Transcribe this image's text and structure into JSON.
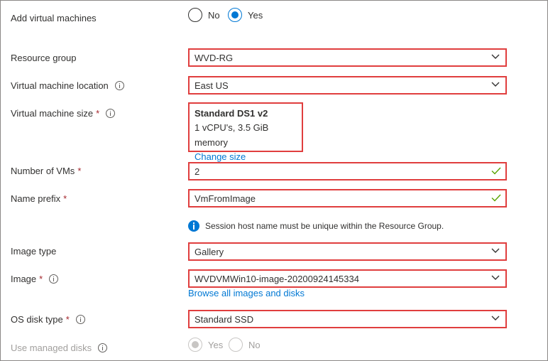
{
  "add_vms": {
    "label": "Add virtual machines",
    "options": [
      "No",
      "Yes"
    ],
    "selected": "Yes"
  },
  "resource_group": {
    "label": "Resource group",
    "value": "WVD-RG"
  },
  "vm_location": {
    "label": "Virtual machine location",
    "value": "East US"
  },
  "vm_size": {
    "label": "Virtual machine size",
    "required": "*",
    "title": "Standard DS1 v2",
    "spec": "1 vCPU's, 3.5 GiB memory",
    "change_link": "Change size"
  },
  "num_vms": {
    "label": "Number of VMs",
    "required": "*",
    "value": "2"
  },
  "name_prefix": {
    "label": "Name prefix",
    "required": "*",
    "value": "VmFromImage"
  },
  "notice": {
    "text": "Session host name must be unique within the Resource Group."
  },
  "image_type": {
    "label": "Image type",
    "value": "Gallery"
  },
  "image": {
    "label": "Image",
    "required": "*",
    "value": "WVDVMWin10-image-20200924145334",
    "browse_link": "Browse all images and disks"
  },
  "os_disk": {
    "label": "OS disk type",
    "required": "*",
    "value": "Standard SSD"
  },
  "managed_disks": {
    "label": "Use managed disks",
    "options": [
      "Yes",
      "No"
    ],
    "selected": "Yes",
    "disabled": true
  },
  "colors": {
    "accent": "#0078d4",
    "highlight_border": "#e03e3e",
    "required": "#a4262c",
    "valid_check": "#57a300"
  },
  "icons": {
    "info": "info-icon",
    "chevron": "chevron-down-icon",
    "check": "checkmark-icon",
    "notice": "info-filled-icon"
  }
}
